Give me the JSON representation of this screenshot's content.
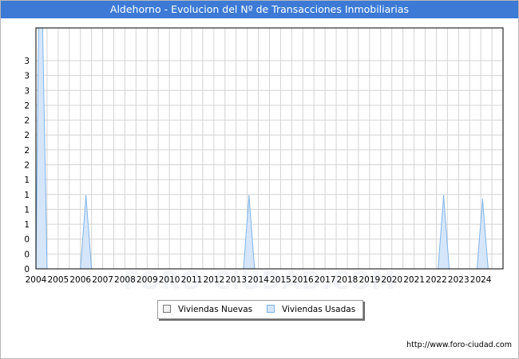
{
  "title": "Aldehorno - Evolucion del Nº de Transacciones Inmobiliarias",
  "footer": "http://www.foro-ciudad.com",
  "watermark": "FORO-CIUDAD.COM",
  "colors": {
    "title_bar": "#3c7ad6",
    "nuevas_fill": "#f2f2f2",
    "usadas_fill": "#d6e6fa",
    "usadas_line": "#7eb4ea",
    "grid": "#d4d4d4",
    "axis": "#000000"
  },
  "chart_data": {
    "type": "area",
    "title": "Aldehorno - Evolucion del Nº de Transacciones Inmobiliarias",
    "xlabel": "",
    "ylabel": "",
    "x_tick_labels": [
      "2004",
      "2005",
      "2006",
      "2007",
      "2008",
      "2009",
      "2010",
      "2011",
      "2012",
      "2013",
      "2014",
      "2015",
      "2016",
      "2017",
      "2018",
      "2019",
      "2020",
      "2021",
      "2022",
      "2023",
      "2024"
    ],
    "y_tick_labels": [
      "0",
      "0",
      "0",
      "1",
      "1",
      "1",
      "1",
      "2",
      "2",
      "2",
      "2",
      "2",
      "3",
      "3",
      "3"
    ],
    "ylim": [
      0,
      3.3
    ],
    "grid": true,
    "legend_position": "bottom",
    "series": [
      {
        "name": "Viviendas Nuevas",
        "x": [
          2004.0,
          2024.5
        ],
        "values": [
          0,
          0
        ]
      },
      {
        "name": "Viviendas Usadas",
        "x": [
          2004.0,
          2004.12,
          2004.3,
          2004.5,
          2006.0,
          2006.25,
          2006.5,
          2013.33,
          2013.58,
          2013.83,
          2022.08,
          2022.33,
          2022.58,
          2023.83,
          2024.08,
          2024.33
        ],
        "values": [
          0,
          3.3,
          3.3,
          0,
          0,
          1,
          0,
          0,
          1,
          0,
          0,
          1,
          0,
          0,
          0.95,
          0
        ]
      }
    ]
  }
}
